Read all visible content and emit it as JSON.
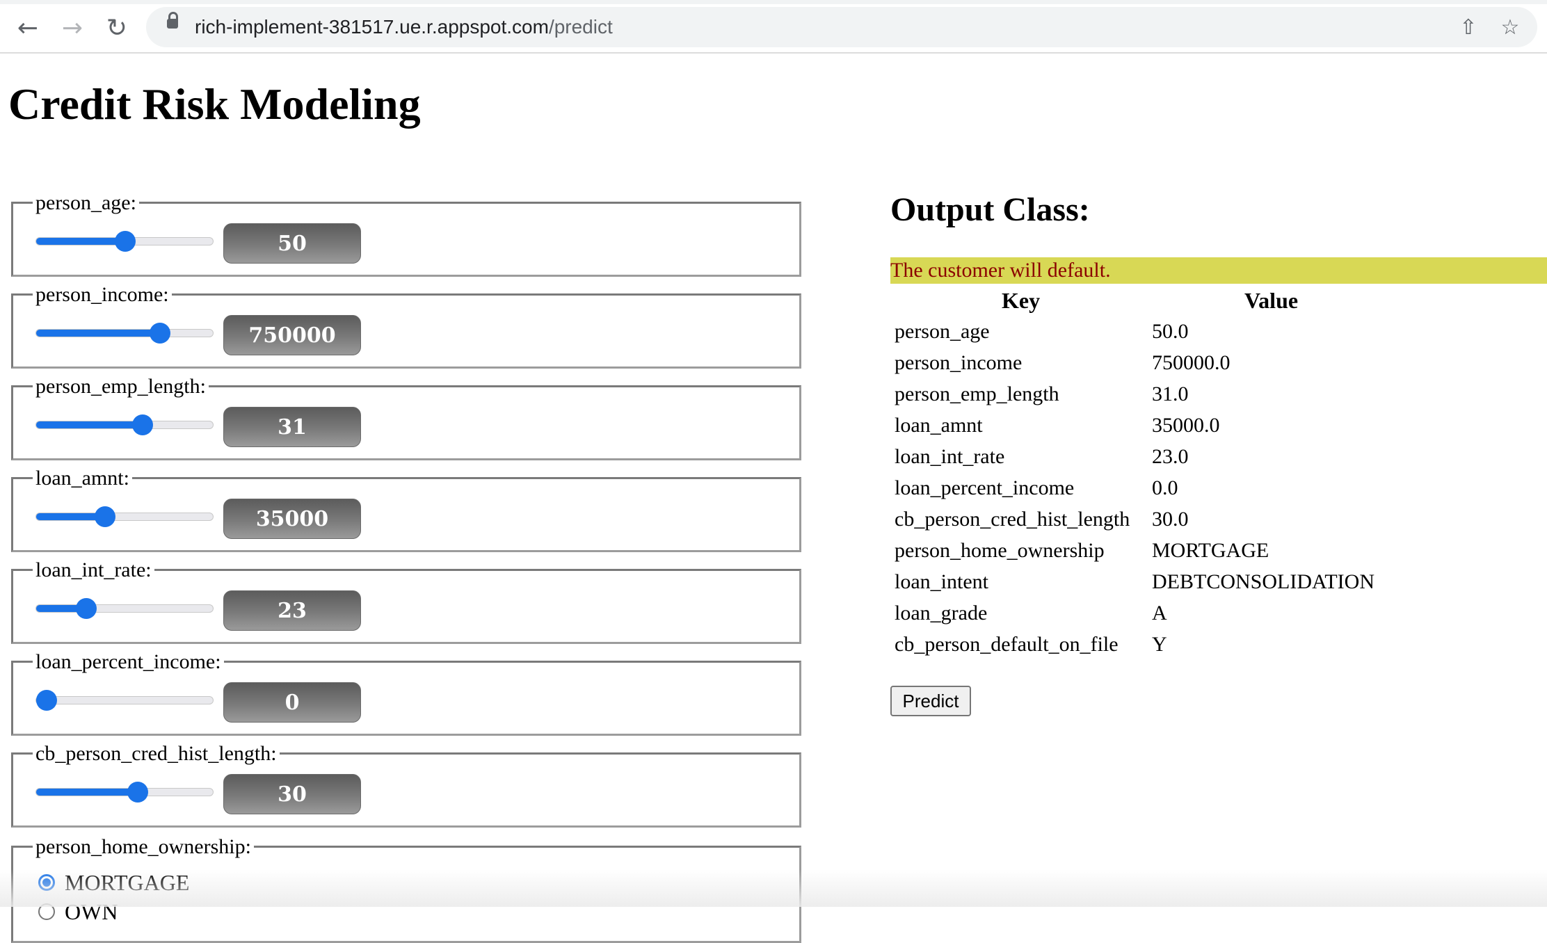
{
  "browser": {
    "url_host": "rich-implement-381517.ue.r.appspot.com",
    "url_path": "/predict",
    "icons": [
      "back-arrow-icon",
      "forward-arrow-icon",
      "reload-icon",
      "lock-icon",
      "share-icon",
      "star-icon"
    ]
  },
  "page": {
    "title": "Credit Risk Modeling"
  },
  "inputs": [
    {
      "label": "person_age:",
      "value": "50",
      "slider_fraction": 0.5
    },
    {
      "label": "person_income:",
      "value": "750000",
      "slider_fraction": 0.72
    },
    {
      "label": "person_emp_length:",
      "value": "31",
      "slider_fraction": 0.61
    },
    {
      "label": "loan_amnt:",
      "value": "35000",
      "slider_fraction": 0.37
    },
    {
      "label": "loan_int_rate:",
      "value": "23",
      "slider_fraction": 0.25
    },
    {
      "label": "loan_percent_income:",
      "value": "0",
      "slider_fraction": 0.0
    },
    {
      "label": "cb_person_cred_hist_length:",
      "value": "30",
      "slider_fraction": 0.58
    }
  ],
  "home_ownership": {
    "label": "person_home_ownership:",
    "options": [
      "MORTGAGE",
      "OWN"
    ],
    "selected": "MORTGAGE"
  },
  "output": {
    "heading": "Output Class:",
    "message": "The customer will default.",
    "col_key": "Key",
    "col_value": "Value",
    "rows": [
      {
        "key": "person_age",
        "value": "50.0"
      },
      {
        "key": "person_income",
        "value": "750000.0"
      },
      {
        "key": "person_emp_length",
        "value": "31.0"
      },
      {
        "key": "loan_amnt",
        "value": "35000.0"
      },
      {
        "key": "loan_int_rate",
        "value": "23.0"
      },
      {
        "key": "loan_percent_income",
        "value": "0.0"
      },
      {
        "key": "cb_person_cred_hist_length",
        "value": "30.0"
      },
      {
        "key": "person_home_ownership",
        "value": "MORTGAGE"
      },
      {
        "key": "loan_intent",
        "value": "DEBTCONSOLIDATION"
      },
      {
        "key": "loan_grade",
        "value": "A"
      },
      {
        "key": "cb_person_default_on_file",
        "value": "Y"
      }
    ],
    "predict_label": "Predict"
  },
  "colors": {
    "accent": "#1a73e8",
    "banner_bg": "#d8d855",
    "banner_text": "#8b0000"
  }
}
